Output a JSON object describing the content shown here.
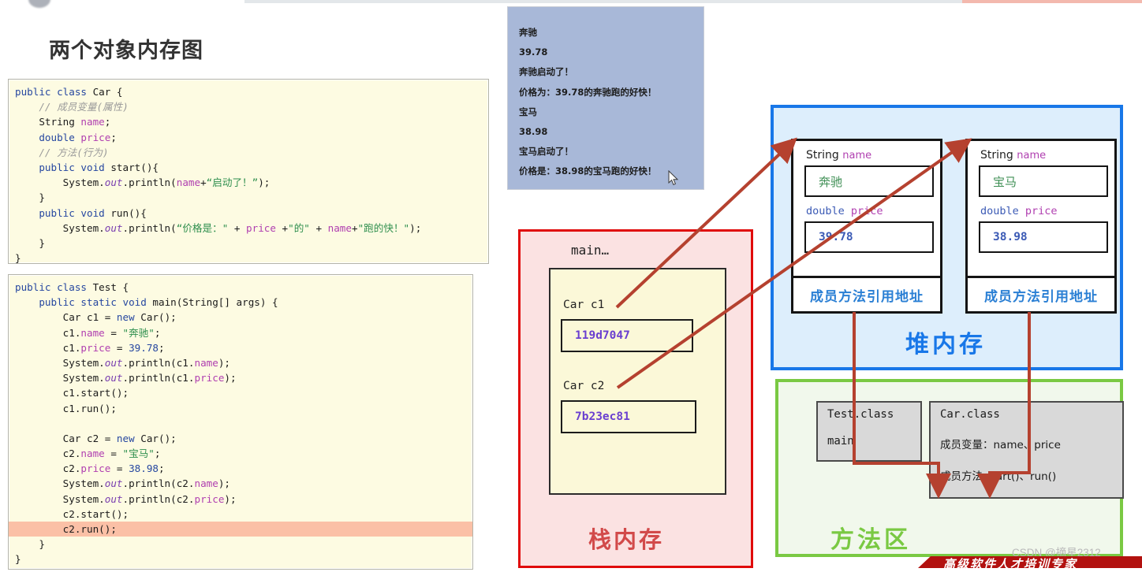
{
  "page": {
    "title": "两个对象内存图",
    "watermark": "CSDN @摘星2312",
    "bottom_banner": "高级软件人才培训专家"
  },
  "code_car": {
    "lines": [
      [
        {
          "t": "public ",
          "c": "kw"
        },
        {
          "t": "class ",
          "c": "kw"
        },
        {
          "t": "Car {",
          "c": "cls"
        }
      ],
      [
        {
          "t": "    // 成员变量(属性)",
          "c": "cmt"
        }
      ],
      [
        {
          "t": "    String ",
          "c": "cls"
        },
        {
          "t": "name",
          "c": "fld"
        },
        {
          "t": ";",
          "c": "pl"
        }
      ],
      [
        {
          "t": "    ",
          "c": "pl"
        },
        {
          "t": "double ",
          "c": "kw"
        },
        {
          "t": "price",
          "c": "fld"
        },
        {
          "t": ";",
          "c": "pl"
        }
      ],
      [
        {
          "t": "    // 方法(行为)",
          "c": "cmt"
        }
      ],
      [
        {
          "t": "    ",
          "c": "pl"
        },
        {
          "t": "public void ",
          "c": "kw"
        },
        {
          "t": "start(){",
          "c": "cls"
        }
      ],
      [
        {
          "t": "        System.",
          "c": "pl"
        },
        {
          "t": "out",
          "c": "it"
        },
        {
          "t": ".println(",
          "c": "pl"
        },
        {
          "t": "name",
          "c": "fld"
        },
        {
          "t": "+",
          "c": "pl"
        },
        {
          "t": "“启动了！”",
          "c": "str"
        },
        {
          "t": ");",
          "c": "pl"
        }
      ],
      [
        {
          "t": "    }",
          "c": "pl"
        }
      ],
      [
        {
          "t": "    ",
          "c": "pl"
        },
        {
          "t": "public void ",
          "c": "kw"
        },
        {
          "t": "run(){",
          "c": "cls"
        }
      ],
      [
        {
          "t": "        System.",
          "c": "pl"
        },
        {
          "t": "out",
          "c": "it"
        },
        {
          "t": ".println(",
          "c": "pl"
        },
        {
          "t": "“价格是：\"",
          "c": "str"
        },
        {
          "t": " + ",
          "c": "pl"
        },
        {
          "t": "price",
          "c": "fld"
        },
        {
          "t": " +",
          "c": "pl"
        },
        {
          "t": "\"的\"",
          "c": "str"
        },
        {
          "t": " + ",
          "c": "pl"
        },
        {
          "t": "name",
          "c": "fld"
        },
        {
          "t": "+",
          "c": "pl"
        },
        {
          "t": "\"跑的快！\"",
          "c": "str"
        },
        {
          "t": ");",
          "c": "pl"
        }
      ],
      [
        {
          "t": "    }",
          "c": "pl"
        }
      ],
      [
        {
          "t": "}",
          "c": "pl"
        }
      ]
    ]
  },
  "code_test": {
    "lines": [
      {
        "hl": false,
        "parts": [
          {
            "t": "public class ",
            "c": "kw"
          },
          {
            "t": "Test {",
            "c": "cls"
          }
        ]
      },
      {
        "hl": false,
        "parts": [
          {
            "t": "    ",
            "c": "pl"
          },
          {
            "t": "public static void ",
            "c": "kw"
          },
          {
            "t": "main(String[] args) {",
            "c": "cls"
          }
        ]
      },
      {
        "hl": false,
        "parts": [
          {
            "t": "        Car c1 = ",
            "c": "pl"
          },
          {
            "t": "new ",
            "c": "kw"
          },
          {
            "t": "Car();",
            "c": "pl"
          }
        ]
      },
      {
        "hl": false,
        "parts": [
          {
            "t": "        c1.",
            "c": "pl"
          },
          {
            "t": "name",
            "c": "fld"
          },
          {
            "t": " = ",
            "c": "pl"
          },
          {
            "t": "\"奔驰\"",
            "c": "str"
          },
          {
            "t": ";",
            "c": "pl"
          }
        ]
      },
      {
        "hl": false,
        "parts": [
          {
            "t": "        c1.",
            "c": "pl"
          },
          {
            "t": "price",
            "c": "fld"
          },
          {
            "t": " = ",
            "c": "pl"
          },
          {
            "t": "39.78",
            "c": "num"
          },
          {
            "t": ";",
            "c": "pl"
          }
        ]
      },
      {
        "hl": false,
        "parts": [
          {
            "t": "        System.",
            "c": "pl"
          },
          {
            "t": "out",
            "c": "it"
          },
          {
            "t": ".println(c1.",
            "c": "pl"
          },
          {
            "t": "name",
            "c": "fld"
          },
          {
            "t": ");",
            "c": "pl"
          }
        ]
      },
      {
        "hl": false,
        "parts": [
          {
            "t": "        System.",
            "c": "pl"
          },
          {
            "t": "out",
            "c": "it"
          },
          {
            "t": ".println(c1.",
            "c": "pl"
          },
          {
            "t": "price",
            "c": "fld"
          },
          {
            "t": ");",
            "c": "pl"
          }
        ]
      },
      {
        "hl": false,
        "parts": [
          {
            "t": "        c1.start();",
            "c": "pl"
          }
        ]
      },
      {
        "hl": false,
        "parts": [
          {
            "t": "        c1.run();",
            "c": "pl"
          }
        ]
      },
      {
        "hl": false,
        "parts": [
          {
            "t": "",
            "c": "pl"
          }
        ]
      },
      {
        "hl": false,
        "parts": [
          {
            "t": "        Car c2 = ",
            "c": "pl"
          },
          {
            "t": "new ",
            "c": "kw"
          },
          {
            "t": "Car();",
            "c": "pl"
          }
        ]
      },
      {
        "hl": false,
        "parts": [
          {
            "t": "        c2.",
            "c": "pl"
          },
          {
            "t": "name",
            "c": "fld"
          },
          {
            "t": " = ",
            "c": "pl"
          },
          {
            "t": "\"宝马\"",
            "c": "str"
          },
          {
            "t": ";",
            "c": "pl"
          }
        ]
      },
      {
        "hl": false,
        "parts": [
          {
            "t": "        c2.",
            "c": "pl"
          },
          {
            "t": "price",
            "c": "fld"
          },
          {
            "t": " = ",
            "c": "pl"
          },
          {
            "t": "38.98",
            "c": "num"
          },
          {
            "t": ";",
            "c": "pl"
          }
        ]
      },
      {
        "hl": false,
        "parts": [
          {
            "t": "        System.",
            "c": "pl"
          },
          {
            "t": "out",
            "c": "it"
          },
          {
            "t": ".println(c2.",
            "c": "pl"
          },
          {
            "t": "name",
            "c": "fld"
          },
          {
            "t": ");",
            "c": "pl"
          }
        ]
      },
      {
        "hl": false,
        "parts": [
          {
            "t": "        System.",
            "c": "pl"
          },
          {
            "t": "out",
            "c": "it"
          },
          {
            "t": ".println(c2.",
            "c": "pl"
          },
          {
            "t": "price",
            "c": "fld"
          },
          {
            "t": ");",
            "c": "pl"
          }
        ]
      },
      {
        "hl": false,
        "parts": [
          {
            "t": "        c2.start();",
            "c": "pl"
          }
        ]
      },
      {
        "hl": true,
        "parts": [
          {
            "t": "        c2.run();",
            "c": "pl"
          }
        ]
      },
      {
        "hl": false,
        "parts": [
          {
            "t": "    }",
            "c": "pl"
          }
        ]
      },
      {
        "hl": false,
        "parts": [
          {
            "t": "}",
            "c": "pl"
          }
        ]
      }
    ]
  },
  "console": {
    "lines": [
      "奔驰",
      "39.78",
      "奔驰启动了！",
      "价格为：39.78的奔驰跑的好快！",
      "宝马",
      "38.98",
      "宝马启动了！",
      "价格是：38.98的宝马跑的好快！"
    ]
  },
  "stack": {
    "title": "栈内存",
    "frame_label": "main…",
    "vars": [
      {
        "label": "Car c1",
        "address": "119d7047"
      },
      {
        "label": "Car c2",
        "address": "7b23ec81"
      }
    ]
  },
  "heap": {
    "title": "堆内存",
    "objects": [
      {
        "name_label": "String",
        "name_field": "name",
        "name_value": "奔驰",
        "price_label": "double",
        "price_field": "price",
        "price_value": "39.78",
        "method_ref": "成员方法引用地址"
      },
      {
        "name_label": "String",
        "name_field": "name",
        "name_value": "宝马",
        "price_label": "double",
        "price_field": "price",
        "price_value": "38.98",
        "method_ref": "成员方法引用地址"
      }
    ]
  },
  "method_area": {
    "title": "方法区",
    "test_class": {
      "name": "Test.class",
      "member": "main"
    },
    "car_class": {
      "name": "Car.class",
      "fields": "成员变量：name、price",
      "methods": "成员方法:start()、run()"
    }
  },
  "colors": {
    "stack_border": "#e00b0b",
    "stack_fill": "#fbe2e2",
    "heap_border": "#1877e8",
    "heap_fill": "#ddeefc",
    "method_border": "#7ac943",
    "method_fill": "#f1f8ec",
    "arrow": "#b5412f",
    "console_bg": "#a8b8d8",
    "code_bg": "#fdfbe2",
    "highlight_line": "#fbc0a6"
  }
}
